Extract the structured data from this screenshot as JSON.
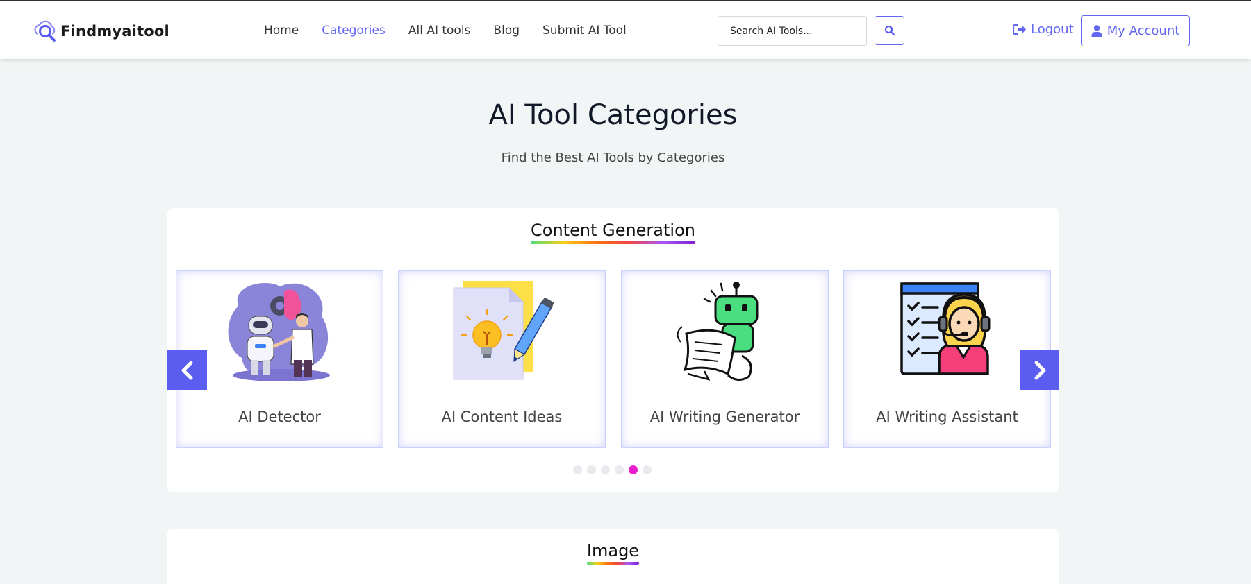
{
  "brand": {
    "name": "Findmyaitool",
    "logo_icon": "magnifier-cloud-icon"
  },
  "nav": {
    "items": [
      {
        "label": "Home",
        "active": false
      },
      {
        "label": "Categories",
        "active": true
      },
      {
        "label": "All AI tools",
        "active": false
      },
      {
        "label": "Blog",
        "active": false
      },
      {
        "label": "Submit AI Tool",
        "active": false
      }
    ]
  },
  "search": {
    "placeholder": "Search AI Tools...",
    "icon": "search-icon"
  },
  "account": {
    "logout_label": "Logout",
    "logout_icon": "sign-out-icon",
    "my_account_label": "My Account",
    "my_account_icon": "user-icon"
  },
  "page": {
    "title": "AI Tool Categories",
    "subtitle": "Find the Best AI Tools by Categories"
  },
  "sections": [
    {
      "title": "Content Generation",
      "tools": [
        {
          "name": "AI Detector",
          "icon": "robot-and-person-illustration"
        },
        {
          "name": "AI Content Ideas",
          "icon": "lightbulb-document-pencil-illustration"
        },
        {
          "name": "AI Writing Generator",
          "icon": "writing-robot-illustration"
        },
        {
          "name": "AI Writing Assistant",
          "icon": "support-agent-checklist-illustration"
        }
      ],
      "carousel": {
        "prev_icon": "chevron-left-icon",
        "next_icon": "chevron-right-icon",
        "page_count": 6,
        "active_page": 5
      }
    },
    {
      "title": "Image"
    }
  ],
  "colors": {
    "accent": "#6366f1",
    "arrow_bg": "#5b5cf0",
    "active_dot": "#e91ecc",
    "page_bg": "#f2f5f5"
  }
}
